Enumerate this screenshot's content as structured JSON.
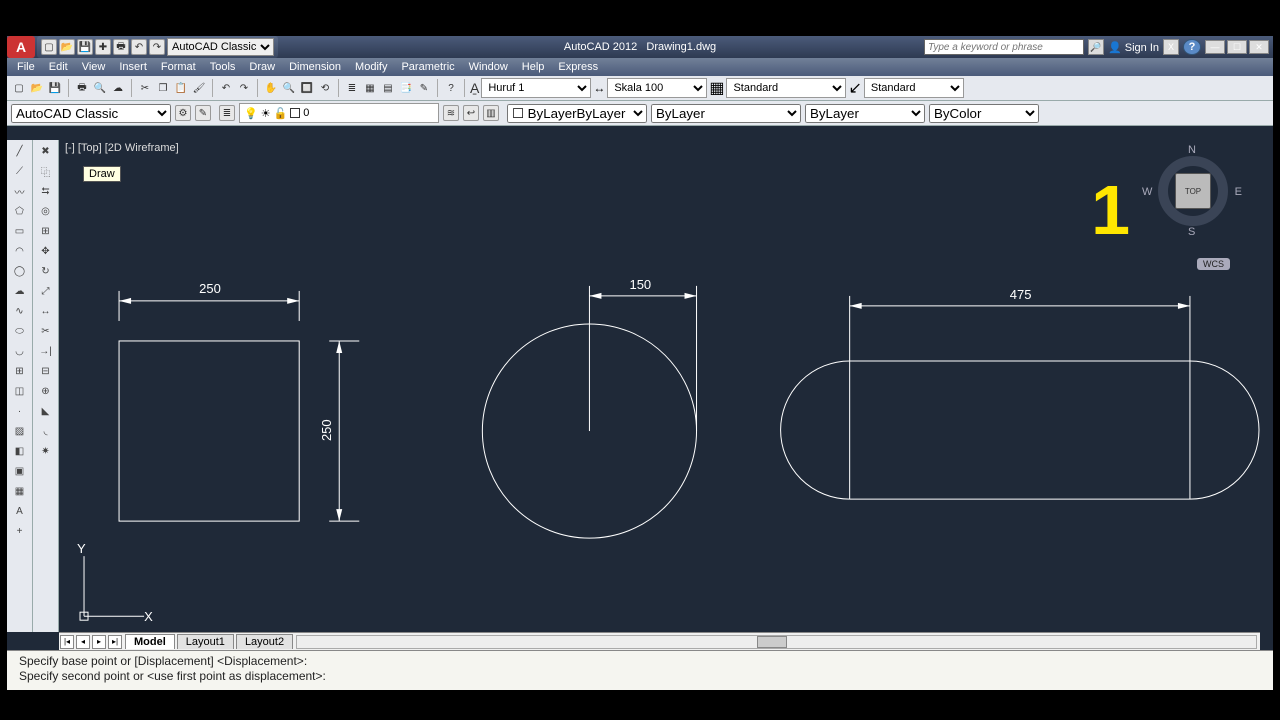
{
  "app": {
    "title": "AutoCAD 2012",
    "doc": "Drawing1.dwg",
    "searchPlaceholder": "Type a keyword or phrase",
    "signin": "Sign In"
  },
  "workspace": "AutoCAD Classic",
  "menus": [
    "File",
    "Edit",
    "View",
    "Insert",
    "Format",
    "Tools",
    "Draw",
    "Dimension",
    "Modify",
    "Parametric",
    "Window",
    "Help",
    "Express"
  ],
  "styles": {
    "textStyle": "Huruf 1",
    "dimStyle": "Skala 100",
    "tableStyle": "Standard",
    "mlStyle": "Standard"
  },
  "layer": {
    "current": "0",
    "color": "ByLayer",
    "ltype": "ByLayer",
    "lweight": "ByLayer",
    "plot": "ByColor"
  },
  "viewport": {
    "label": "[-] [Top] [2D Wireframe]",
    "tooltip": "Draw",
    "cube": "TOP",
    "wcs": "WCS",
    "N": "N",
    "S": "S",
    "E": "E",
    "W": "W"
  },
  "overlay": {
    "one": "1"
  },
  "tabs": {
    "model": "Model",
    "l1": "Layout1",
    "l2": "Layout2"
  },
  "cmd": {
    "l1": "Specify base point or [Displacement] <Displacement>:",
    "l2": "Specify second point or <use first point as displacement>:"
  },
  "drawing": {
    "square": {
      "dimTop": "250",
      "dimRight": "250"
    },
    "circle": {
      "dimRadius": "150"
    },
    "slot": {
      "dimWidth": "475"
    },
    "ucs": {
      "x": "X",
      "y": "Y"
    }
  }
}
